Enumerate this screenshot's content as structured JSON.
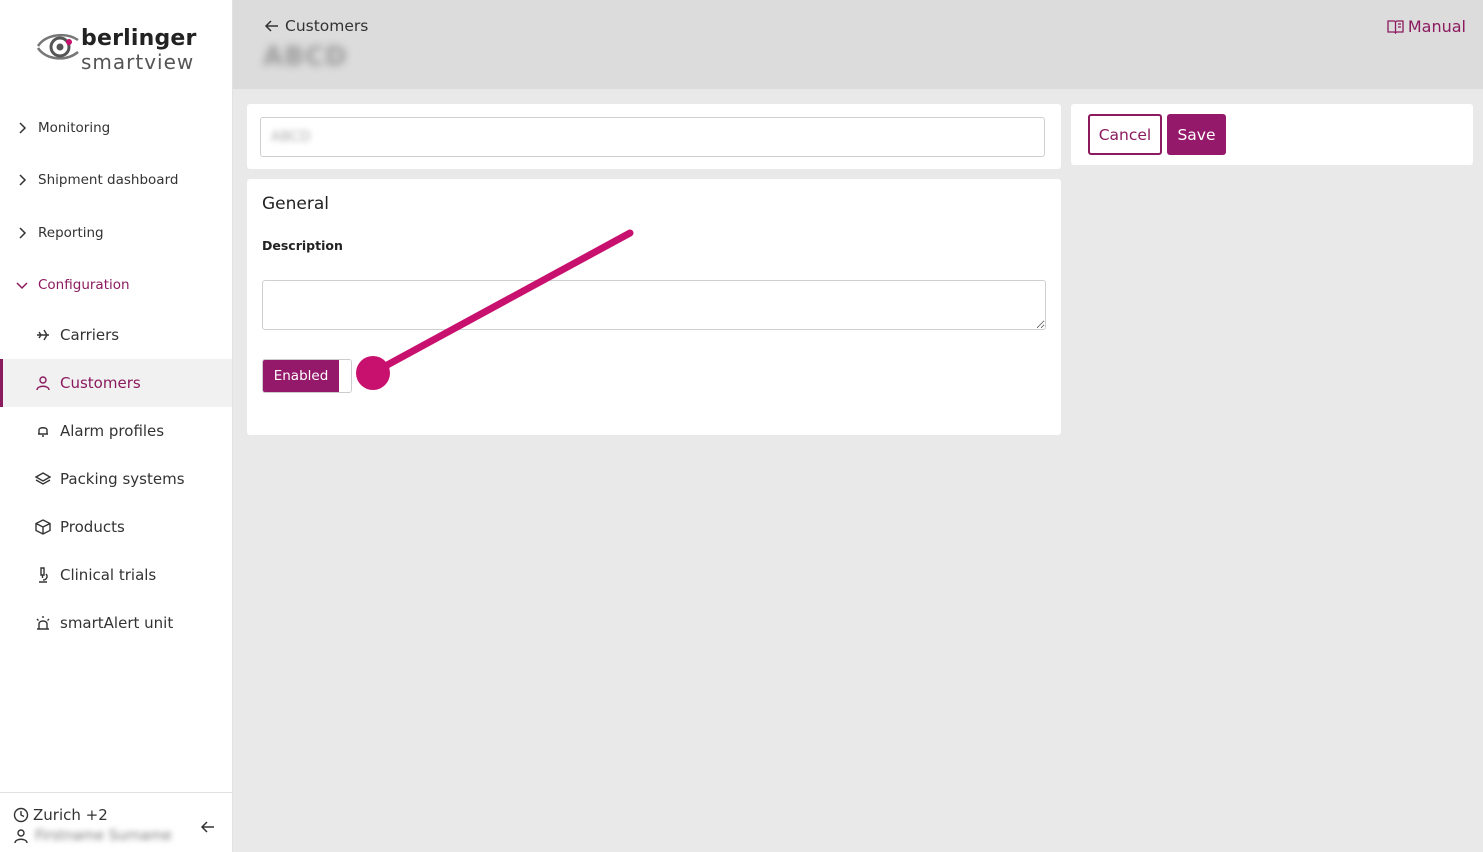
{
  "brand": {
    "line1": "berlinger",
    "line2": "smartview"
  },
  "sidebar": {
    "groups": [
      {
        "label": "Monitoring"
      },
      {
        "label": "Shipment dashboard"
      },
      {
        "label": "Reporting"
      },
      {
        "label": "Configuration"
      }
    ],
    "items": [
      {
        "label": "Carriers",
        "icon": "airplane-icon"
      },
      {
        "label": "Customers",
        "icon": "user-icon"
      },
      {
        "label": "Alarm profiles",
        "icon": "bell-icon"
      },
      {
        "label": "Packing systems",
        "icon": "layers-icon"
      },
      {
        "label": "Products",
        "icon": "box-icon"
      },
      {
        "label": "Clinical trials",
        "icon": "microscope-icon"
      },
      {
        "label": "smartAlert unit",
        "icon": "alert-light-icon"
      }
    ],
    "footer": {
      "timezone": "Zurich +2",
      "username": "Firstname Surname"
    }
  },
  "header": {
    "back_label": "Customers",
    "title": "ABCD",
    "manual_label": "Manual"
  },
  "form": {
    "name_value": "ABCD",
    "section_title": "General",
    "description_label": "Description",
    "description_value": "",
    "toggle_label": "Enabled",
    "enabled": true
  },
  "actions": {
    "cancel_label": "Cancel",
    "save_label": "Save"
  },
  "colors": {
    "accent": "#95196b",
    "annotation": "#c8106e"
  }
}
